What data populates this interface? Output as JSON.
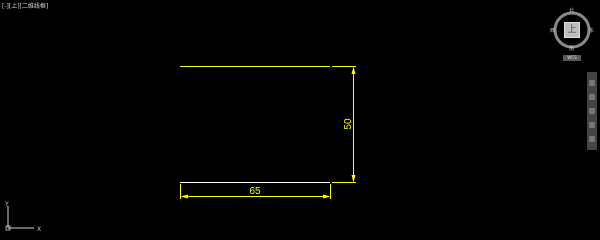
{
  "viewport": {
    "label": "[-][上][二维线框]"
  },
  "drawing": {
    "dimensions": [
      {
        "name": "vertical-dimension",
        "text": "50"
      },
      {
        "name": "horizontal-dimension",
        "text": "65"
      }
    ],
    "colors": {
      "geometry": "#ffffff",
      "dimension": "#ffff00",
      "background": "#000000"
    }
  },
  "viewcube": {
    "face_label": "上",
    "north": "北",
    "south": "南",
    "east": "东",
    "west": "西",
    "wcs_label": "WCS"
  },
  "navbar": {
    "buttons": [
      "full-navigation-wheel-icon",
      "pan-icon",
      "zoom-icon",
      "orbit-icon",
      "showmotion-icon"
    ]
  },
  "ucs_icon": {
    "x_label": "X",
    "y_label": "Y"
  }
}
